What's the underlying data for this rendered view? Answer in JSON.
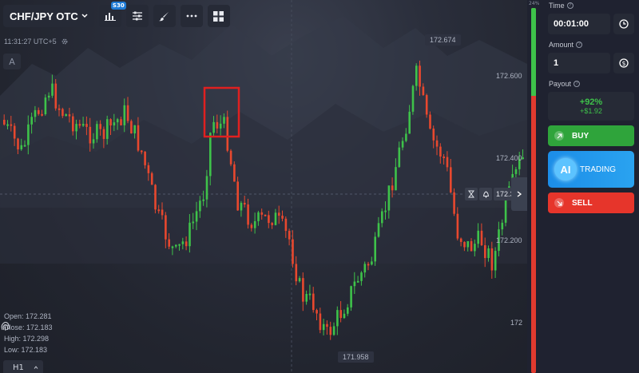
{
  "toolbar": {
    "asset": "CHF/JPY OTC",
    "indicator_badge": "S30"
  },
  "chart": {
    "clock": "11:31:27 UTC+5",
    "drawing_letter": "A",
    "price_labels": [
      "172.674",
      "172.600",
      "172.400",
      "172.200",
      "172",
      "171.958"
    ],
    "current_price": "172.3",
    "ohlc": {
      "open": "Open: 172.281",
      "close": "Close: 172.183",
      "high": "High: 172.298",
      "low": "Low: 172.183"
    },
    "timeframe": "H1",
    "colors": {
      "up": "#3ec24a",
      "down": "#e8482e",
      "highlight": "#e02020"
    }
  },
  "sentiment": {
    "label": "24%",
    "up_fraction": 0.24
  },
  "panel": {
    "time_label": "Time",
    "time_value": "00:01:00",
    "amount_label": "Amount",
    "amount_value": "1",
    "payout_label": "Payout",
    "payout_percent": "+92%",
    "payout_amount": "+$1.92",
    "buy_label": "BUY",
    "ai_label": "AI",
    "ai_trading_label": "TRADING",
    "sell_label": "SELL",
    "colors": {
      "buy": "#2fa43b",
      "sell": "#e6352b",
      "ai": "#1c8de8"
    }
  }
}
